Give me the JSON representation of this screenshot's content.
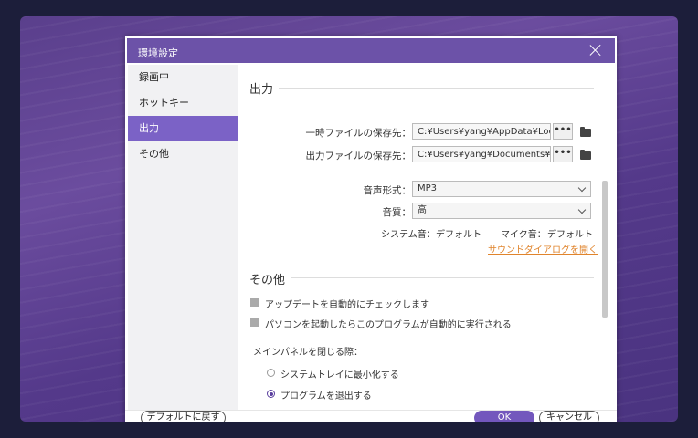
{
  "dialog": {
    "title": "環境設定"
  },
  "sidebar": {
    "items": [
      {
        "label": "録画中"
      },
      {
        "label": "ホットキー"
      },
      {
        "label": "出力"
      },
      {
        "label": "その他"
      }
    ],
    "active": "出力"
  },
  "output": {
    "section_title": "出力",
    "temp_label": "一時ファイルの保存先：",
    "temp_path": "C:¥Users¥yang¥AppData¥Loca",
    "output_label": "出力ファイルの保存先：",
    "output_path": "C:¥Users¥yang¥Documents¥A",
    "dots": "•••",
    "audio_format_label": "音声形式：",
    "audio_format_value": "MP3",
    "quality_label": "音質：",
    "quality_value": "高",
    "system_sound_label": "システム音：",
    "system_sound_value": "デフォルト",
    "mic_label": "マイク音：",
    "mic_value": "デフォルト",
    "sound_dialog_link": "サウンドダイアログを開く"
  },
  "other": {
    "section_title": "その他",
    "auto_update": "アップデートを自動的にチェックします",
    "auto_start": "パソコンを起動したらこのプログラムが自動的に実行される",
    "close_label": "メインパネルを閉じる際：",
    "minimize_option": "システムトレイに最小化する",
    "exit_option": "プログラムを退出する",
    "selected_option": "exit"
  },
  "footer": {
    "default_button": "デフォルトに戻す",
    "ok_button": "OK",
    "cancel_button": "キャンセル"
  },
  "colors": {
    "accent": "#7357bd",
    "titlebar": "#6c52a8",
    "link": "#e0842c"
  }
}
